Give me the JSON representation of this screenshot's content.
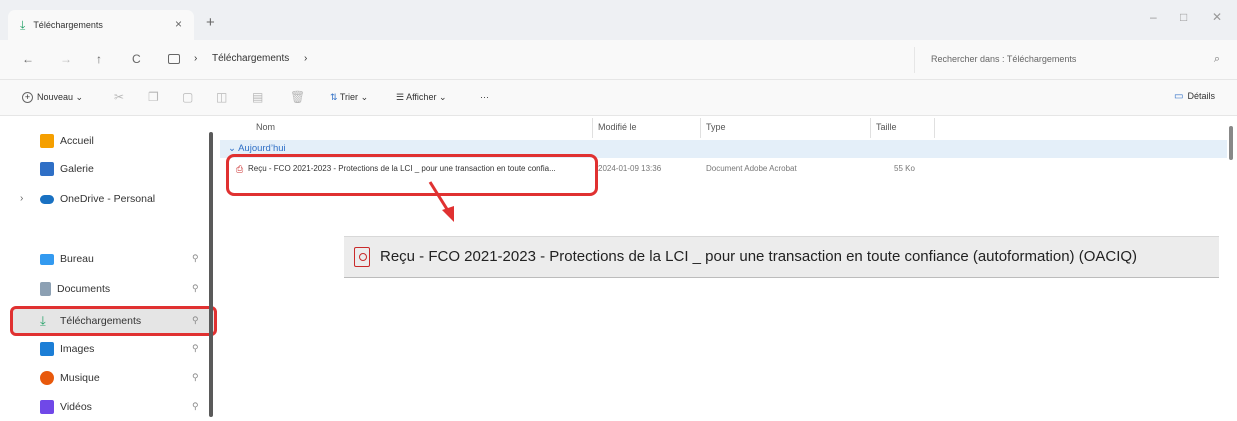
{
  "window": {
    "tab_title": "Téléchargements",
    "tab_close": "×",
    "new_tab": "+",
    "controls": {
      "minimize": "–",
      "maximize": "□",
      "close": "✕"
    }
  },
  "address": {
    "back": "←",
    "forward": "→",
    "up": "↑",
    "refresh": "C",
    "breadcrumb": [
      "Téléchargements"
    ],
    "chevron": "›",
    "search_placeholder": "Rechercher dans : Téléchargements",
    "search_icon": "⌕"
  },
  "commands": {
    "new": "Nouveau",
    "sort": "Trier",
    "view": "Afficher",
    "more": "···",
    "details": "Détails"
  },
  "sidebar": {
    "items": [
      {
        "label": "Accueil",
        "icon": "home-icon",
        "color": "#f59f00"
      },
      {
        "label": "Galerie",
        "icon": "gallery-icon",
        "color": "#2f6fc6"
      },
      {
        "label": "OneDrive - Personal",
        "icon": "cloud-icon",
        "color": "#1971c2"
      },
      {
        "label": "Bureau",
        "icon": "desktop-icon",
        "color": "#339af0"
      },
      {
        "label": "Documents",
        "icon": "document-icon",
        "color": "#8ca0b3"
      },
      {
        "label": "Téléchargements",
        "icon": "download-icon",
        "color": "#26a269"
      },
      {
        "label": "Images",
        "icon": "image-icon",
        "color": "#1c7ed6"
      },
      {
        "label": "Musique",
        "icon": "music-icon",
        "color": "#e8590c"
      },
      {
        "label": "Vidéos",
        "icon": "video-icon",
        "color": "#7048e8"
      }
    ],
    "expand_chevron": "›",
    "pin": "📌"
  },
  "list": {
    "columns": [
      "Nom",
      "Modifié le",
      "Type",
      "Taille"
    ],
    "group": "Aujourd’hui",
    "group_chevron": "⌄",
    "files": [
      {
        "name": "Reçu - FCO 2021-2023 - Protections de la LCI _ pour une transaction en toute confia...",
        "modified": "2024-01-09 13:36",
        "type": "Document Adobe Acrobat",
        "size": "55 Ko"
      }
    ]
  },
  "zoom": {
    "full_name": "Reçu - FCO 2021-2023 - Protections de la LCI _  pour une transaction en toute confiance (autoformation) (OACIQ)"
  },
  "colors": {
    "highlight_red": "#e03131",
    "accent_blue": "#2f6fc6",
    "group_bg": "#e4eff9"
  }
}
